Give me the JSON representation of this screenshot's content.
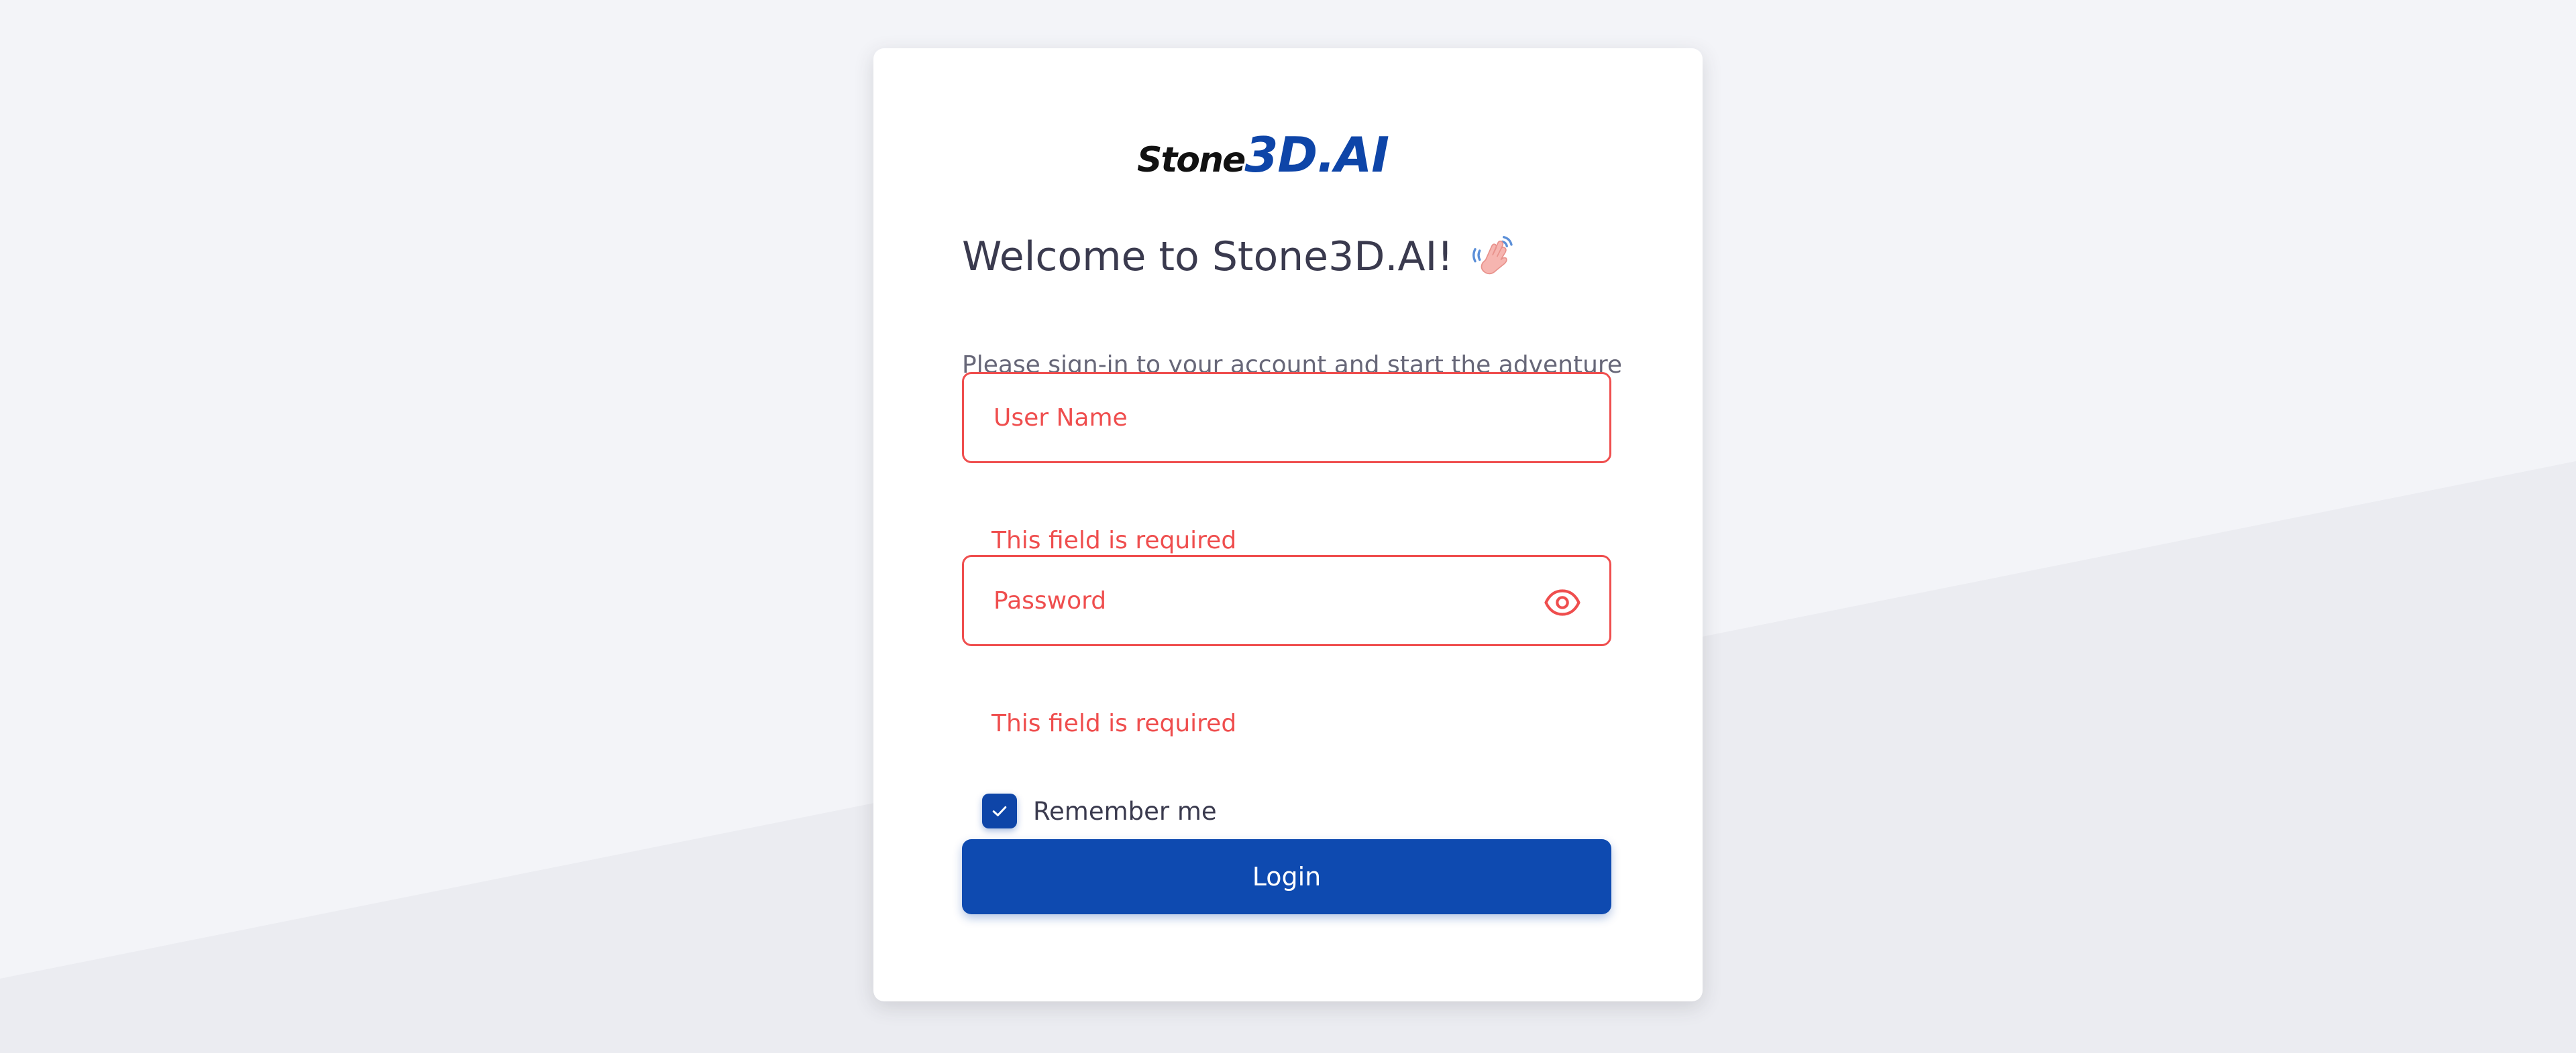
{
  "brand": {
    "logo_part1": "Stone",
    "logo_part2": "3D.AI",
    "logo_part2_color": "#0e45a8"
  },
  "login": {
    "title": "Welcome to Stone3D.AI!",
    "title_icon": "waving-hand-icon",
    "subtitle": "Please sign-in to your account and start the adventure",
    "username": {
      "value": "",
      "placeholder": "User Name",
      "error": "This field is required"
    },
    "password": {
      "value": "",
      "placeholder": "Password",
      "error": "This field is required",
      "toggle_icon": "eye-icon"
    },
    "remember": {
      "label": "Remember me",
      "checked": true
    },
    "submit_label": "Login"
  },
  "colors": {
    "accent": "#0e4ab0",
    "error": "#ef4e4e",
    "background": "#f3f4f8"
  }
}
